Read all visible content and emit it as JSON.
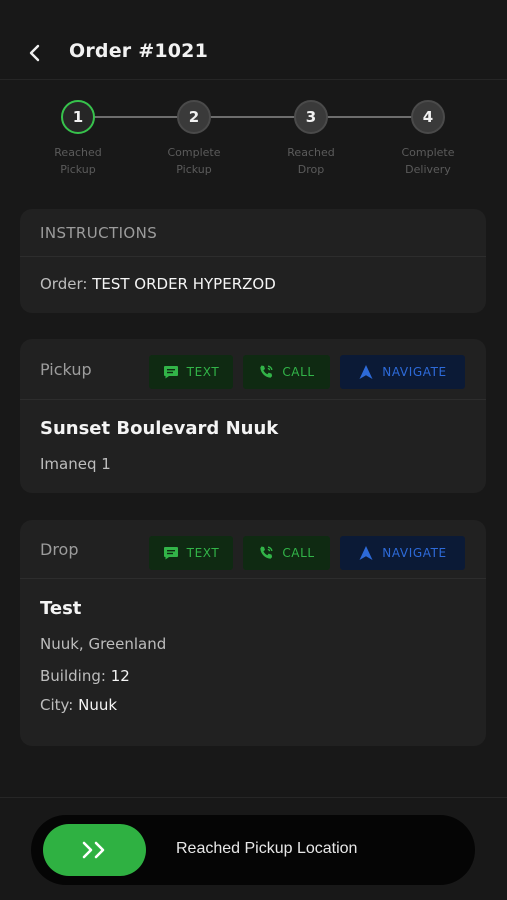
{
  "header": {
    "title": "Order #1021",
    "back_icon": "chevron-left-icon"
  },
  "stepper": {
    "steps": [
      {
        "number": "1",
        "label_line1": "Reached",
        "label_line2": "Pickup",
        "active": true
      },
      {
        "number": "2",
        "label_line1": "Complete",
        "label_line2": "Pickup",
        "active": false
      },
      {
        "number": "3",
        "label_line1": "Reached",
        "label_line2": "Drop",
        "active": false
      },
      {
        "number": "4",
        "label_line1": "Complete",
        "label_line2": "Delivery",
        "active": false
      }
    ],
    "active_color": "#37c24c"
  },
  "instructions": {
    "title": "INSTRUCTIONS",
    "order_label": "Order:",
    "order_value": "TEST ORDER HYPERZOD"
  },
  "pickup": {
    "title": "Pickup",
    "text_button": "TEXT",
    "call_button": "CALL",
    "navigate_button": "NAVIGATE",
    "name": "Sunset Boulevard Nuuk",
    "address": "Imaneq 1"
  },
  "drop": {
    "title": "Drop",
    "text_button": "TEXT",
    "call_button": "CALL",
    "navigate_button": "NAVIGATE",
    "name": "Test",
    "address": "Nuuk, Greenland",
    "building_label": "Building:",
    "building_value": "12",
    "city_label": "City:",
    "city_value": "Nuuk"
  },
  "action_slider": {
    "label": "Reached Pickup Location",
    "knob_icon": "double-chevron-right-icon"
  },
  "colors": {
    "green": "#2fb142",
    "navigate_blue": "#2d6ad8",
    "background": "#181818",
    "card": "#212121"
  }
}
